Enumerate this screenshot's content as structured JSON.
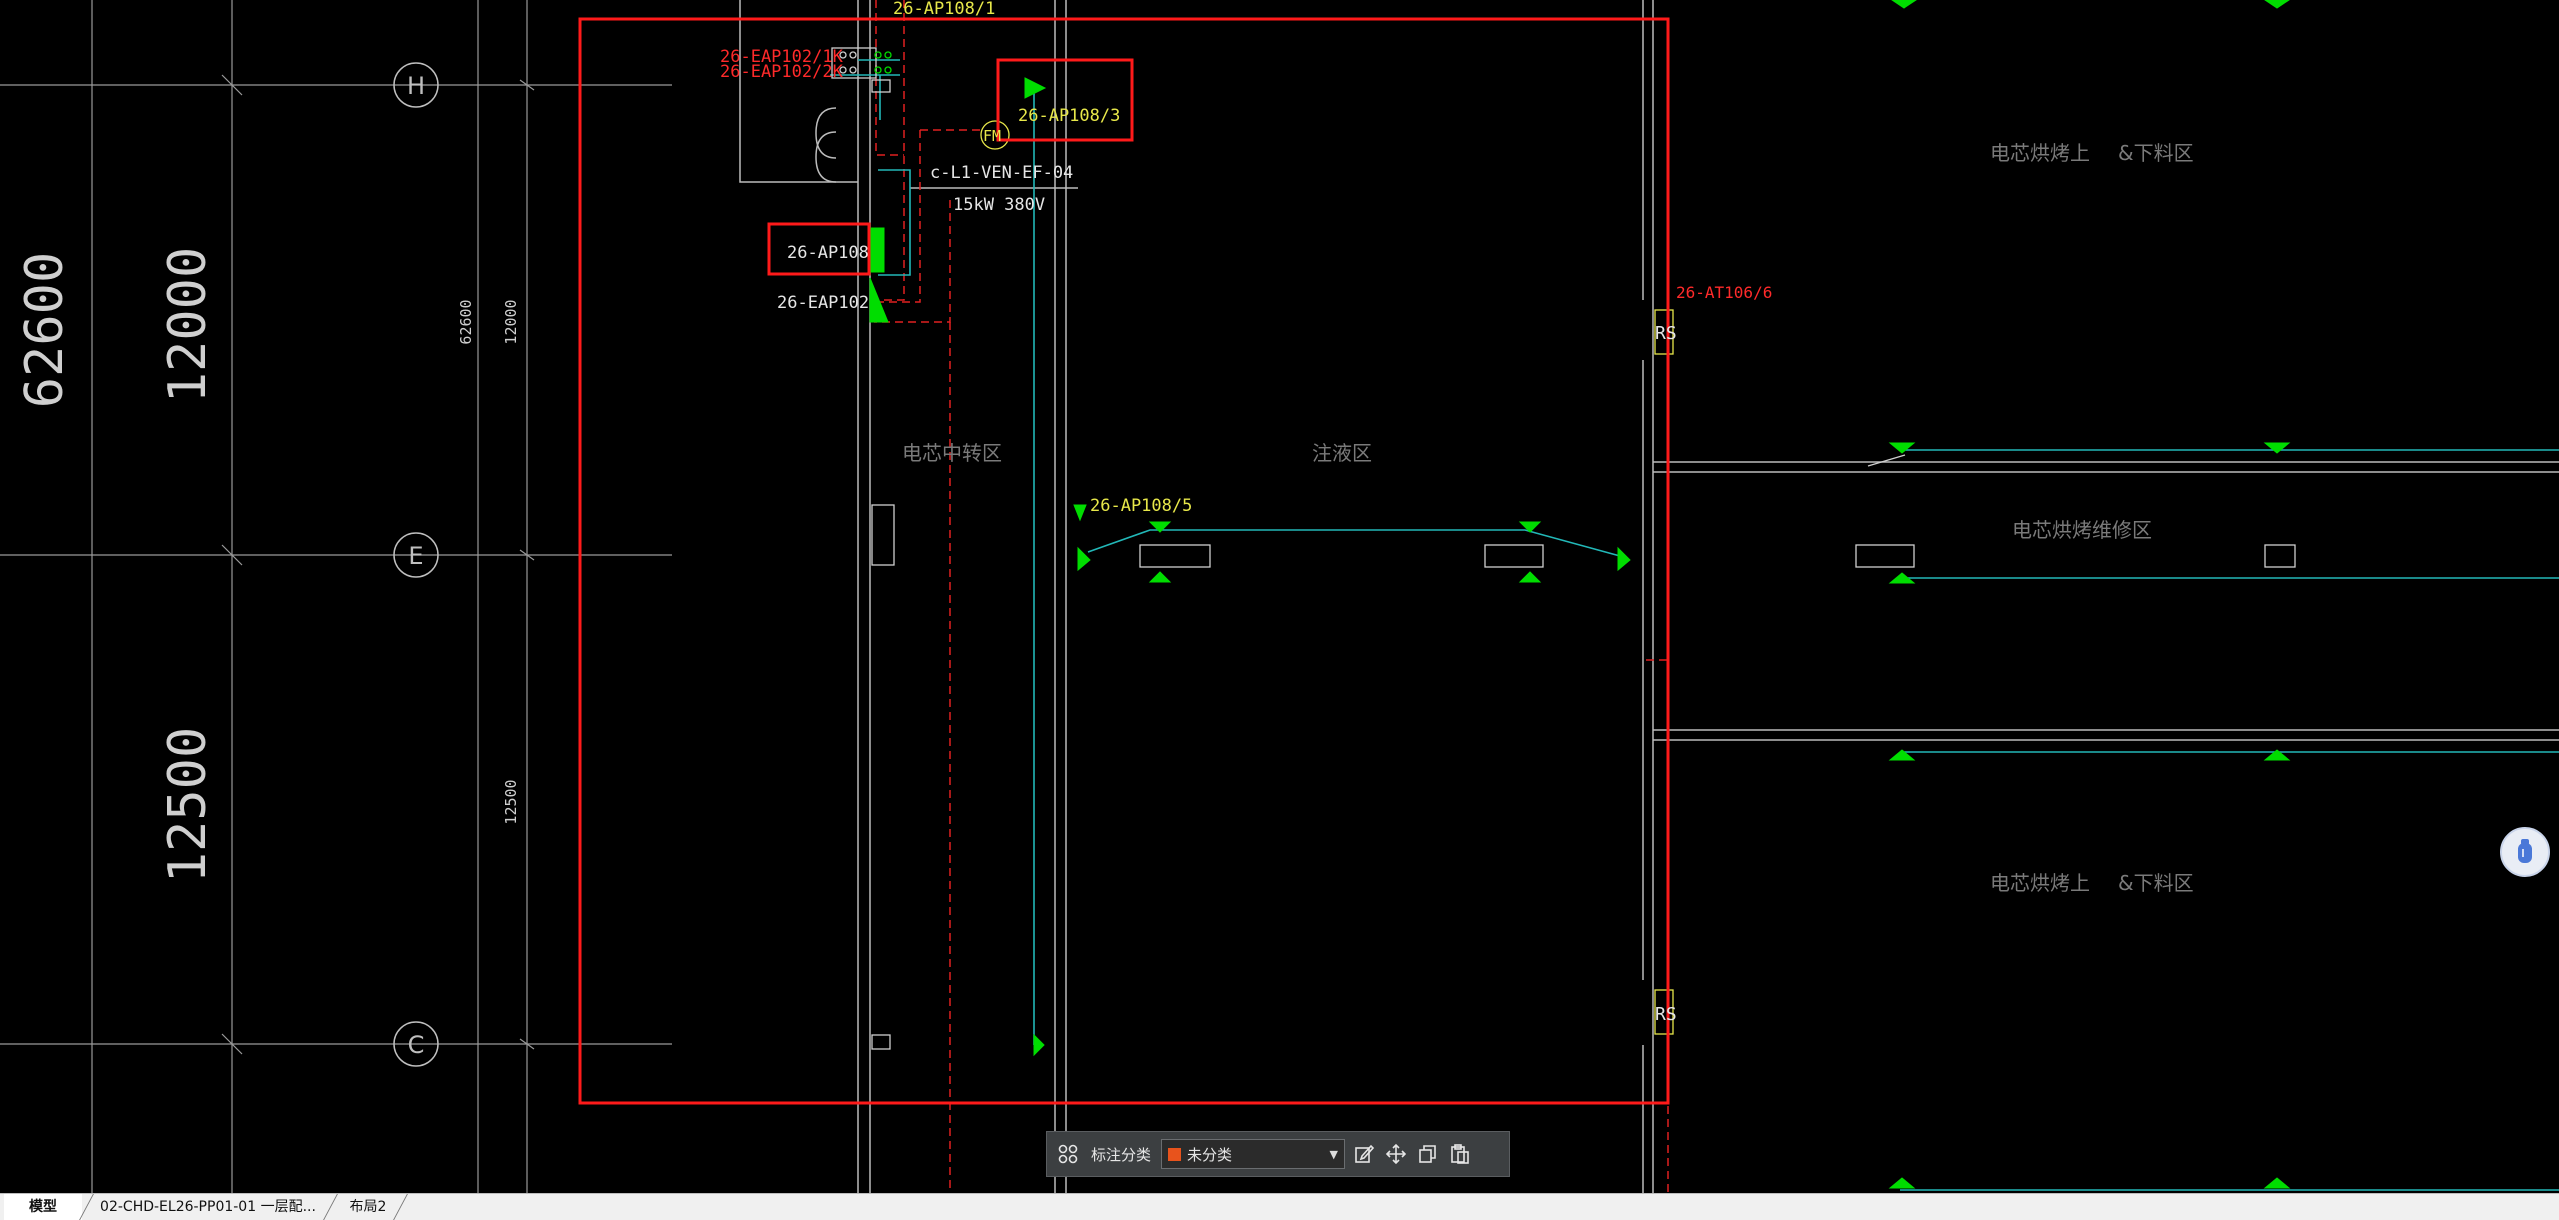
{
  "labels": {
    "dim_62600_large": "62600",
    "dim_12000_large": "12000",
    "dim_12500_large": "12500",
    "dim_62600_small": "62600",
    "dim_12000_small": "12000",
    "dim_12500_small": "12500",
    "axis_h": "H",
    "axis_e": "E",
    "axis_c": "C",
    "ap108_1": "26-AP108/1",
    "eap102_1k": "26-EAP102/1K",
    "eap102_2k": "26-EAP102/2K",
    "ap108_3": "26-AP108/3",
    "fm": "FM",
    "ven_ef": "c-L1-VEN-EF-04",
    "ven_power": "15kW 380V",
    "ap108": "26-AP108",
    "eap102": "26-EAP102",
    "at106": "26-AT106/6",
    "rs1": "RS",
    "rs2": "RS",
    "zone_cell_transfer": "电芯中转区",
    "zone_injection": "注液区",
    "ap108_5": "26-AP108/5",
    "zone_bake_load_1": "电芯烘烤上",
    "zone_unload_1": "&下料区",
    "zone_bake_repair": "电芯烘烤维修区",
    "zone_bake_load_2": "电芯烘烤上",
    "zone_unload_2": "&下料区"
  },
  "toolbar": {
    "label": "标注分类",
    "select_value": "未分类",
    "swatch_color": "#e8531c",
    "icons": [
      "grid-icon",
      "edit-icon",
      "move-icon",
      "copy-icon",
      "paste-icon"
    ]
  },
  "tabs": [
    {
      "label": "模型",
      "active": true
    },
    {
      "label": "02-CHD-EL26-PP01-01 一层配...",
      "active": false
    },
    {
      "label": "布局2",
      "active": false
    }
  ],
  "colors": {
    "background": "#000000",
    "highlight": "#ff1a1a",
    "cyan": "#22b8b8",
    "green": "#00e000",
    "yellow": "#e8e84a",
    "red_text": "#ff2a2a",
    "grid": "#bfbfbf"
  }
}
